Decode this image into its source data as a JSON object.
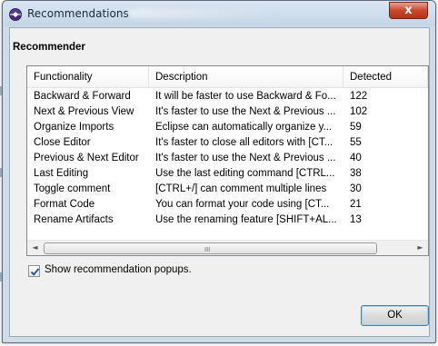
{
  "window": {
    "title": "Recommendations",
    "close_label": "x"
  },
  "section": {
    "title": "Recommender"
  },
  "table": {
    "columns": [
      "Functionality",
      "Description",
      "Detected"
    ],
    "rows": [
      [
        "Backward & Forward",
        "It will be faster to use Backward & Fo...",
        "122"
      ],
      [
        "Next & Previous View",
        "It's faster to use the Next & Previous ...",
        "102"
      ],
      [
        "Organize Imports",
        "Eclipse can automatically organize y...",
        "59"
      ],
      [
        "Close Editor",
        "It's faster to close all editors with [CT...",
        "55"
      ],
      [
        "Previous & Next Editor",
        "It's faster to use the Next & Previous ...",
        "40"
      ],
      [
        "Last Editing",
        "Use the last editing command [CTRL...",
        "38"
      ],
      [
        "Toggle comment",
        "[CTRL+/] can comment multiple lines",
        "30"
      ],
      [
        "Format Code",
        "You can format your code using [CT...",
        "21"
      ],
      [
        "Rename Artifacts",
        "Use the renaming feature [SHIFT+AL...",
        "13"
      ]
    ]
  },
  "scrollbar": {
    "left_arrow": "◄",
    "right_arrow": "►",
    "grip": "III"
  },
  "checkbox": {
    "label": "Show recommendation popups.",
    "checked": true
  },
  "buttons": {
    "ok_label": "OK"
  },
  "colors": {
    "frame": "#cfdbe7",
    "close_button": "#c8472f",
    "button_focus": "#3c7fb1"
  }
}
